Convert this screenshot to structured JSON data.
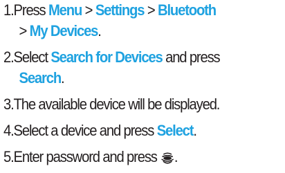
{
  "steps": [
    {
      "number": "1.",
      "press": "Press",
      "menu": "Menu",
      "sep1": ">",
      "settings": "Settings",
      "sep2": ">",
      "bluetooth": "Bluetooth",
      "sep3": ">",
      "my_devices": "My Devices",
      "end": "."
    },
    {
      "number": "2.",
      "select": "Select",
      "search_for_devices": "Search for Devices",
      "and_press": "and press",
      "search": "Search",
      "end": "."
    },
    {
      "number": "3.",
      "text": "The available device will be displayed."
    },
    {
      "number": "4.",
      "text": "Select a device and press",
      "select": "Select",
      "end": "."
    },
    {
      "number": "5.",
      "text": "Enter password and press",
      "icon": "ok-key-icon",
      "end": "."
    }
  ],
  "colors": {
    "keyword": "#1fa2e0",
    "text": "#231f20"
  }
}
